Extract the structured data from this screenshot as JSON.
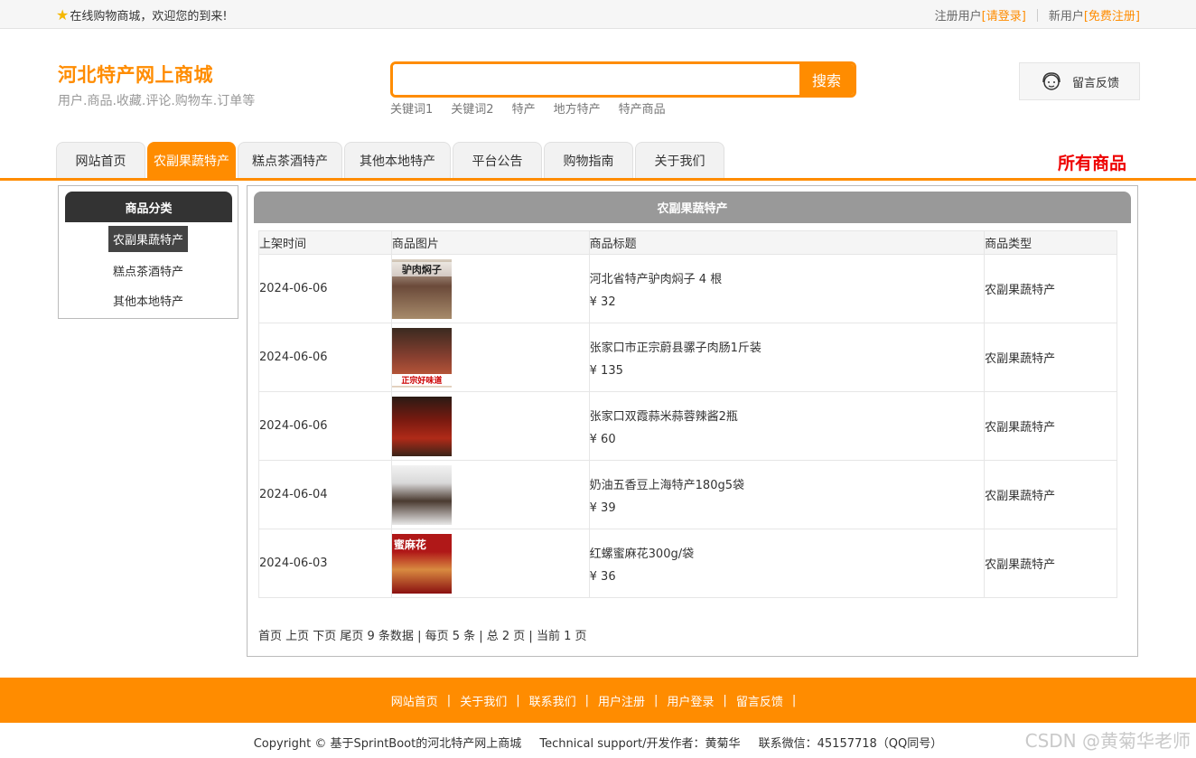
{
  "topbar": {
    "welcome": "在线购物商城，欢迎您的到来!",
    "register_user_label": "注册用户",
    "login_link": "[请登录]",
    "new_user_label": "新用户",
    "register_link": "[免费注册]"
  },
  "header": {
    "title": "河北特产网上商城",
    "subtitle": "用户.商品.收藏.评论.购物车.订单等",
    "search_placeholder": "",
    "search_button": "搜索",
    "keywords": [
      "关键词1",
      "关键词2",
      "特产",
      "地方特产",
      "特产商品"
    ],
    "feedback": "留言反馈"
  },
  "nav": {
    "tabs": [
      "网站首页",
      "农副果蔬特产",
      "糕点茶酒特产",
      "其他本地特产",
      "平台公告",
      "购物指南",
      "关于我们"
    ],
    "active_tab": "农副果蔬特产",
    "all_goods": "所有商品"
  },
  "sidebar": {
    "title": "商品分类",
    "items": [
      "农副果蔬特产",
      "糕点茶酒特产",
      "其他本地特产"
    ],
    "active_item": "农副果蔬特产"
  },
  "main": {
    "title": "农副果蔬特产",
    "columns": [
      "上架时间",
      "商品图片",
      "商品标题",
      "商品类型"
    ],
    "rows": [
      {
        "date": "2024-06-06",
        "image_text": "驴肉焖子",
        "title": "河北省特产驴肉焖子 4 根",
        "price": "¥ 32",
        "type": "农副果蔬特产"
      },
      {
        "date": "2024-06-06",
        "image_text": "正宗好味道",
        "title": "张家口市正宗蔚县骡子肉肠1斤装",
        "price": "¥ 135",
        "type": "农副果蔬特产"
      },
      {
        "date": "2024-06-06",
        "image_text": "",
        "title": "张家口双霞蒜米蒜蓉辣酱2瓶",
        "price": "¥ 60",
        "type": "农副果蔬特产"
      },
      {
        "date": "2024-06-04",
        "image_text": "",
        "title": "奶油五香豆上海特产180g5袋",
        "price": "¥ 39",
        "type": "农副果蔬特产"
      },
      {
        "date": "2024-06-03",
        "image_text": "蜜麻花",
        "title": "红螺蜜麻花300g/袋",
        "price": "¥ 36",
        "type": "农副果蔬特产"
      }
    ],
    "pager": "首页 上页 下页 尾页 9 条数据 | 每页 5 条 | 总 2 页 | 当前 1 页"
  },
  "footer": {
    "links": [
      "网站首页",
      "关于我们",
      "联系我们",
      "用户注册",
      "用户登录",
      "留言反馈"
    ],
    "copyright": "Copyright © 基于SprintBoot的河北特产网上商城",
    "support": "Technical support/开发作者：黄菊华",
    "contact": "联系微信：45157718（QQ同号）",
    "watermark": "CSDN @黄菊华老师"
  },
  "colors": {
    "accent": "#ff8c00",
    "all_goods": "#ee0000",
    "sidebar_head": "#333333",
    "main_head": "#999999"
  }
}
